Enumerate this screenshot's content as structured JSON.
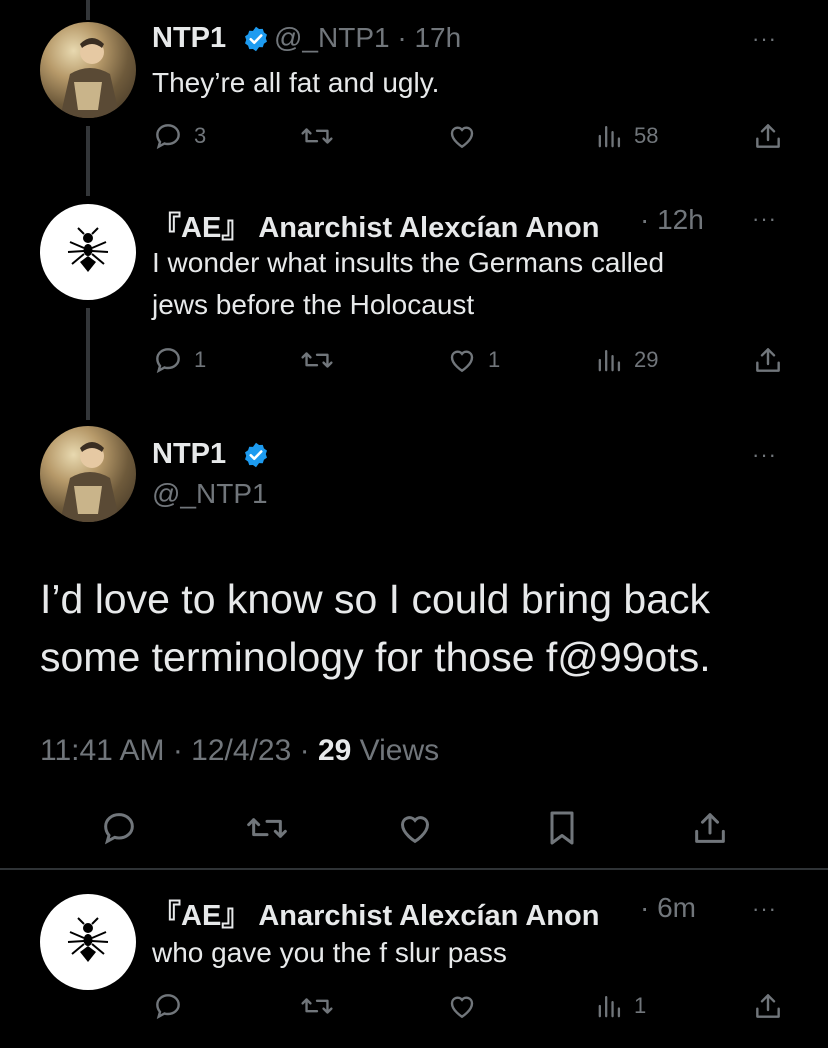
{
  "tweets": [
    {
      "name": "NTP1",
      "handle": "@_NTP1",
      "time": "· 17h",
      "text": "They’re all fat and ugly.",
      "replies": "3",
      "likes": "",
      "views": "58",
      "more": "···"
    },
    {
      "name": "『AE』 Anarchist Alexcían Anon",
      "time": "· 12h",
      "text_line1": "I wonder what insults the Germans called",
      "text_line2": "jews before the Holocaust",
      "replies": "1",
      "likes": "1",
      "views": "29",
      "more": "···"
    }
  ],
  "main": {
    "name": "NTP1",
    "handle": "@_NTP1",
    "text_line1": "I’d love to know so I could bring back",
    "text_line2": "some terminology for those f@99ots.",
    "time": "11:41 AM · 12/4/23 · ",
    "views_count": "29",
    "views_label": " Views",
    "more": "···"
  },
  "reply": {
    "name": "『AE』 Anarchist Alexcían Anon",
    "time": "· 6m",
    "text": "who gave you the f slur pass",
    "views": "1",
    "more": "···"
  },
  "colors": {
    "background": "#000000",
    "text": "#e7e9ea",
    "muted": "#71767b",
    "verified": "#1d9bf0",
    "divider": "#2f3336"
  }
}
